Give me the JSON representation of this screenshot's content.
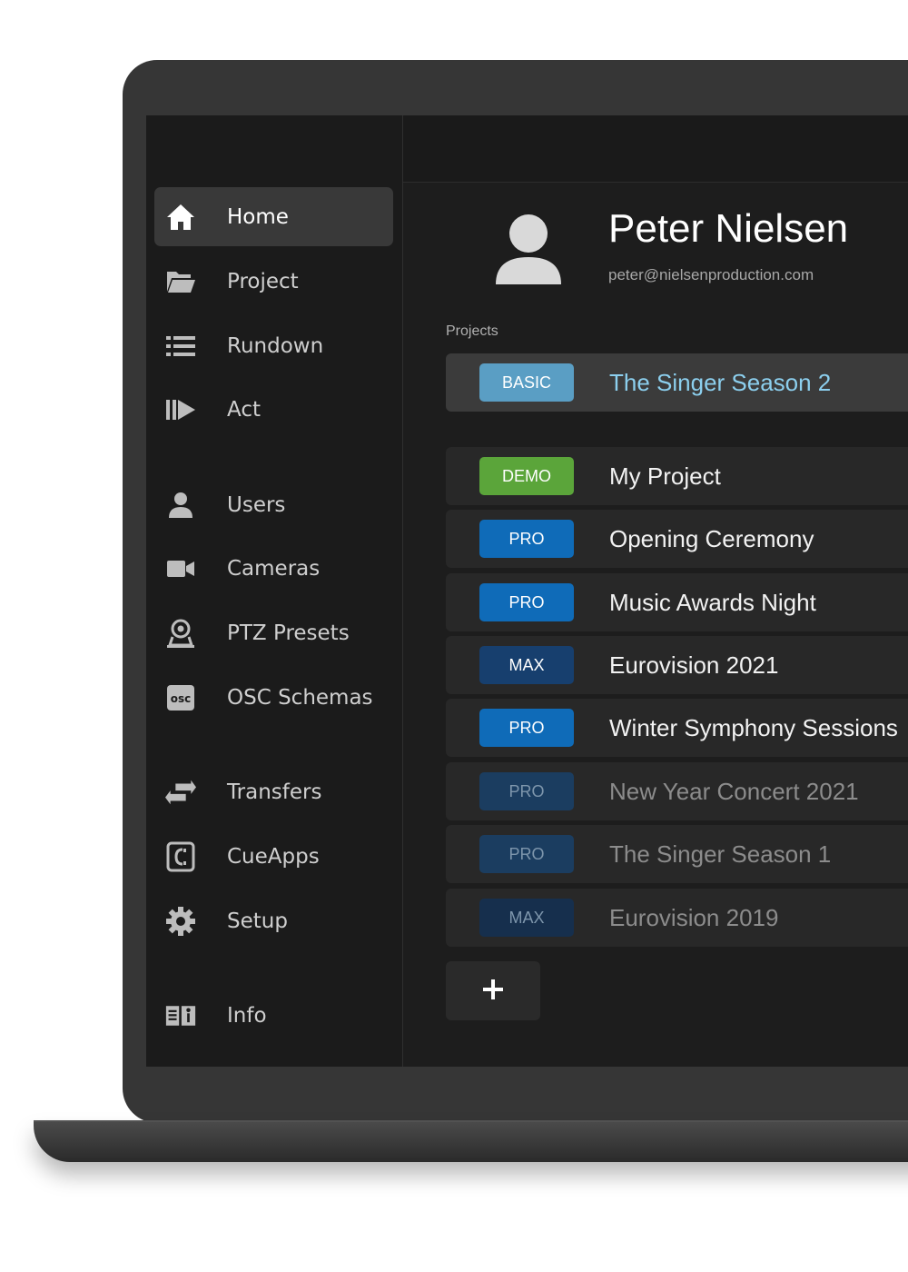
{
  "sidebar": {
    "items": [
      {
        "label": "Home",
        "icon": "home-icon",
        "active": true
      },
      {
        "label": "Project",
        "icon": "folder-icon"
      },
      {
        "label": "Rundown",
        "icon": "list-icon"
      },
      {
        "label": "Act",
        "icon": "play-act-icon"
      },
      {
        "label": "Users",
        "icon": "user-icon"
      },
      {
        "label": "Cameras",
        "icon": "camera-icon"
      },
      {
        "label": "PTZ Presets",
        "icon": "ptz-camera-icon"
      },
      {
        "label": "OSC Schemas",
        "icon": "osc-icon",
        "icon_text": "osc"
      },
      {
        "label": "Transfers",
        "icon": "transfer-arrows-icon"
      },
      {
        "label": "CueApps",
        "icon": "cueapps-icon"
      },
      {
        "label": "Setup",
        "icon": "gear-icon"
      },
      {
        "label": "Info",
        "icon": "info-book-icon"
      }
    ]
  },
  "user": {
    "name": "Peter Nielsen",
    "email": "peter@nielsenproduction.com",
    "avatar_icon": "avatar-icon"
  },
  "projects": {
    "section_label": "Projects",
    "active": {
      "badge": "BASIC",
      "name": "The Singer Season 2",
      "badge_color": "#5a9ec4"
    },
    "items": [
      {
        "badge": "DEMO",
        "name": "My Project",
        "badge_color": "#5ba53a"
      },
      {
        "badge": "PRO",
        "name": "Opening Ceremony",
        "badge_color": "#0f6bb8"
      },
      {
        "badge": "PRO",
        "name": "Music Awards Night",
        "badge_color": "#0f6bb8"
      },
      {
        "badge": "MAX",
        "name": "Eurovision 2021",
        "badge_color": "#173f6e"
      },
      {
        "badge": "PRO",
        "name": "Winter Symphony Sessions",
        "badge_color": "#0f6bb8"
      },
      {
        "badge": "PRO",
        "name": "New Year Concert 2021",
        "badge_color": "#1b3d60",
        "dimmed": true
      },
      {
        "badge": "PRO",
        "name": "The Singer Season 1",
        "badge_color": "#1b3d60",
        "dimmed": true
      },
      {
        "badge": "MAX",
        "name": "Eurovision 2019",
        "badge_color": "#162f4d",
        "dimmed": true
      }
    ],
    "add_button_icon": "plus-icon"
  },
  "colors": {
    "accent_text": "#8ccfee",
    "screen_bg": "#1c1c1c",
    "laptop_frame": "#363636"
  }
}
